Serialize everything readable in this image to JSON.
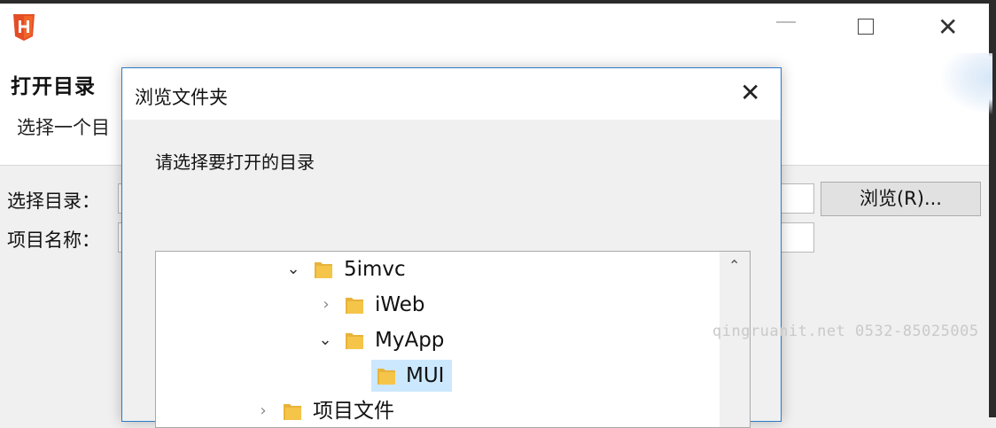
{
  "window": {
    "title": "打开目录",
    "subtitle": "选择一个目"
  },
  "form": {
    "dir_label": "选择目录：",
    "name_label": "项目名称：",
    "browse_label": "浏览(R)..."
  },
  "browse_dialog": {
    "title": "浏览文件夹",
    "instruction": "请选择要打开的目录",
    "tree": [
      {
        "label": "5imvc",
        "expanded": true
      },
      {
        "label": "iWeb",
        "expanded": false
      },
      {
        "label": "MyApp",
        "expanded": true
      },
      {
        "label": "MUI",
        "selected": true
      },
      {
        "label": "项目文件",
        "expanded": false
      }
    ]
  },
  "watermark": "qingruanit.net 0532-85025005",
  "icons": {
    "app": "hbuilder-logo-icon",
    "folder": "folder-icon",
    "close": "close-icon",
    "minimize": "minimize-icon",
    "maximize": "maximize-icon"
  },
  "colors": {
    "selection": "#cce8ff",
    "folder": "#f5c54a",
    "dialog_border": "#2d7bc7",
    "logo": "#e44d26"
  }
}
